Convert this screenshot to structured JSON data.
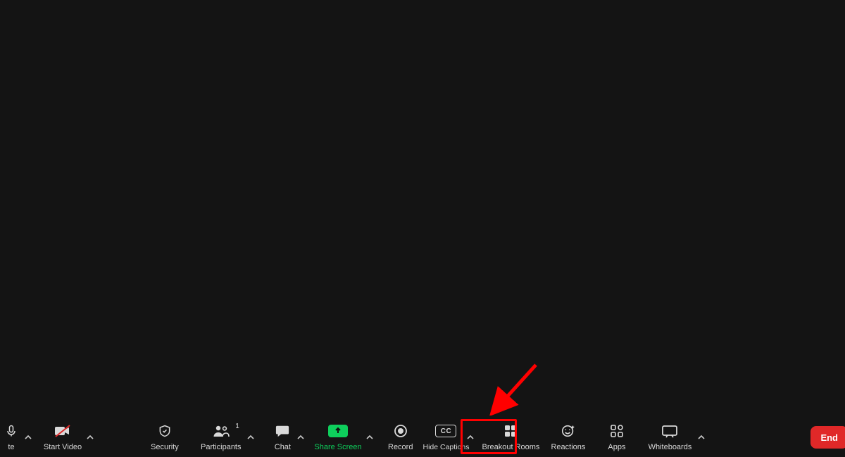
{
  "toolbar": {
    "mute": {
      "label": "te"
    },
    "start_video": {
      "label": "Start Video"
    },
    "security": {
      "label": "Security"
    },
    "participants": {
      "label": "Participants",
      "count": "1"
    },
    "chat": {
      "label": "Chat"
    },
    "share_screen": {
      "label": "Share Screen"
    },
    "record": {
      "label": "Record"
    },
    "captions": {
      "label": "Hide Captions",
      "cc": "CC"
    },
    "breakout": {
      "label": "Breakout Rooms"
    },
    "reactions": {
      "label": "Reactions"
    },
    "apps": {
      "label": "Apps"
    },
    "whiteboards": {
      "label": "Whiteboards"
    },
    "end": {
      "label": "End"
    }
  },
  "annotation": {
    "color": "#ff0000"
  }
}
